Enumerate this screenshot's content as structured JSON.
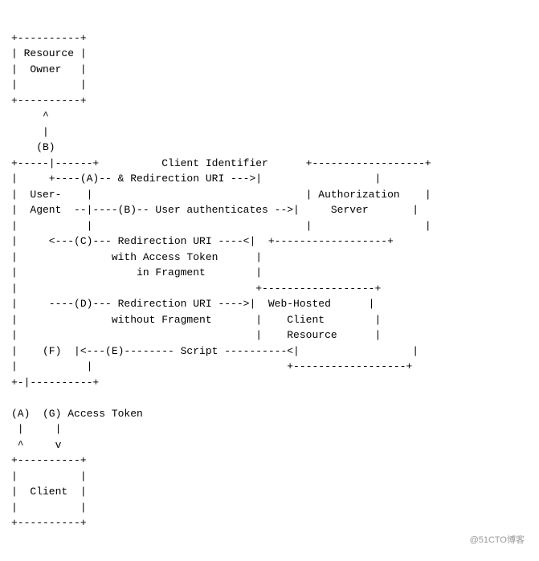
{
  "diagram": {
    "lines": [
      "+----------+",
      "| Resource |",
      "|  Owner   |",
      "|          |",
      "+----------+",
      "     ^",
      "     |",
      "    (B)",
      "+-----|------+          Client Identifier      +------------------+",
      "|     +----(A)-- & Redirection URI --->|                  |",
      "|  User-    |                           | Authorization    |",
      "|  Agent  --|----(B)-- User authenticates -->|     Server       |",
      "|           |                           |                  |",
      "|     <---(C)--- Redirection URI ----<| +------------------+",
      "|               with Access Token      |",
      "|                   in Fragment        |",
      "|                                      +------------------+",
      "|     ----(D)--- Redirection URI ---->|  Web-Hosted      |",
      "|               without Fragment       |    Client        |",
      "|                                      |    Resource      |",
      "|    (F)  |<---(E)-------- Script ----------<|                  |",
      "|           |                           +------------------+",
      "+-|----------+",
      "",
      "(A)  (G) Access Token",
      " |     |",
      " ^     v",
      "+----------+",
      "|          |",
      "|  Client  |",
      "|          |",
      "+----------+"
    ],
    "watermark": "@51CTO博客"
  }
}
